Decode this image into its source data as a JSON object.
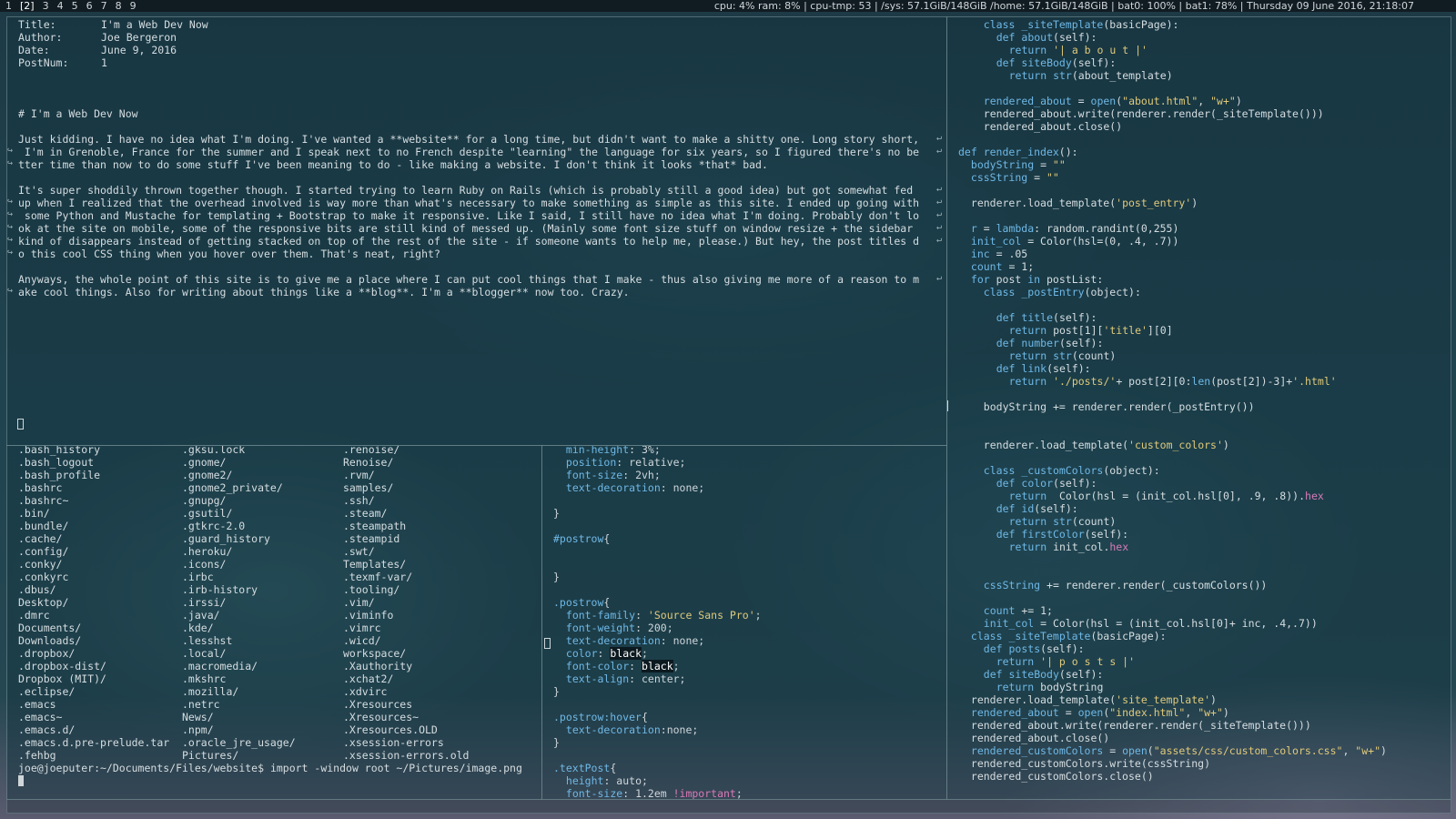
{
  "topbar": {
    "workspaces": [
      {
        "label": "1",
        "active": false
      },
      {
        "label": "[2]",
        "active": true
      },
      {
        "label": "3",
        "active": false
      },
      {
        "label": "4",
        "active": false
      },
      {
        "label": "5",
        "active": false
      },
      {
        "label": "6",
        "active": false
      },
      {
        "label": "7",
        "active": false
      },
      {
        "label": "8",
        "active": false
      },
      {
        "label": "9",
        "active": false
      }
    ],
    "sysinfo": "cpu: 4% ram: 8% | cpu-tmp: 53 | /sys: 57.1GiB/148GiB /home: 57.1GiB/148GiB | bat0: 100% | bat1: 78% | Thursday 09 June 2016, 21:18:07"
  },
  "post": {
    "meta": [
      {
        "key": "Title:",
        "value": "I'm a Web Dev Now"
      },
      {
        "key": "Author:",
        "value": "Joe Bergeron"
      },
      {
        "key": "Date:",
        "value": "June 9, 2016"
      },
      {
        "key": "PostNum:",
        "value": "1"
      }
    ],
    "lines": [
      {
        "row": 7,
        "text": "# I'm a Web Dev Now"
      },
      {
        "row": 9,
        "text": "Just kidding. I have no idea what I'm doing. I've wanted a **website** for a long time, but didn't want to make a shitty one. Long story short,",
        "wrap": true
      },
      {
        "row": 10,
        "text": " I'm in Grenoble, France for the summer and I speak next to no French despite \"learning\" the language for six years, so I figured there's no be",
        "wrap": true,
        "cont": true
      },
      {
        "row": 11,
        "text": "tter time than now to do some stuff I've been meaning to do - like making a website. I don't think it looks *that* bad.",
        "cont": true
      },
      {
        "row": 13,
        "text": "It's super shoddily thrown together though. I started trying to learn Ruby on Rails (which is probably still a good idea) but got somewhat fed",
        "wrap": true
      },
      {
        "row": 14,
        "text": "up when I realized that the overhead involved is way more than what's necessary to make something as simple as this site. I ended up going with",
        "wrap": true,
        "cont": true
      },
      {
        "row": 15,
        "text": " some Python and Mustache for templating + Bootstrap to make it responsive. Like I said, I still have no idea what I'm doing. Probably don't lo",
        "wrap": true,
        "cont": true
      },
      {
        "row": 16,
        "text": "ok at the site on mobile, some of the responsive bits are still kind of messed up. (Mainly some font size stuff on window resize + the sidebar",
        "wrap": true,
        "cont": true
      },
      {
        "row": 17,
        "text": "kind of disappears instead of getting stacked on top of the rest of the site - if someone wants to help me, please.) But hey, the post titles d",
        "wrap": true,
        "cont": true
      },
      {
        "row": 18,
        "text": "o this cool CSS thing when you hover over them. That's neat, right?",
        "cont": true
      },
      {
        "row": 20,
        "text": "Anyways, the whole point of this site is to give me a place where I can put cool things that I make - thus also giving me more of a reason to m",
        "wrap": true
      },
      {
        "row": 21,
        "text": "ake cool things. Also for writing about things like a **blog**. I'm a **blogger** now too. Crazy.",
        "cont": true
      }
    ]
  },
  "ls": {
    "columns": [
      [
        ".bash_history",
        ".bash_logout",
        ".bash_profile",
        ".bashrc",
        ".bashrc~",
        ".bin/",
        ".bundle/",
        ".cache/",
        ".config/",
        ".conky/",
        ".conkyrc",
        ".dbus/",
        "Desktop/",
        ".dmrc",
        "Documents/",
        "Downloads/",
        ".dropbox/",
        ".dropbox-dist/",
        "Dropbox (MIT)/",
        ".eclipse/",
        ".emacs",
        ".emacs~",
        ".emacs.d/",
        ".emacs.d.pre-prelude.tar",
        ".fehbg"
      ],
      [
        ".gksu.lock",
        ".gnome/",
        ".gnome2/",
        ".gnome2_private/",
        ".gnupg/",
        ".gsutil/",
        ".gtkrc-2.0",
        ".guard_history",
        ".heroku/",
        ".icons/",
        ".irbc",
        ".irb-history",
        ".irssi/",
        ".java/",
        ".kde/",
        ".lesshst",
        ".local/",
        ".macromedia/",
        ".mkshrc",
        ".mozilla/",
        ".netrc",
        "News/",
        ".npm/",
        ".oracle_jre_usage/",
        "Pictures/"
      ],
      [
        ".renoise/",
        "Renoise/",
        ".rvm/",
        "samples/",
        ".ssh/",
        ".steam/",
        ".steampath",
        ".steampid",
        ".swt/",
        "Templates/",
        ".texmf-var/",
        ".tooling/",
        ".vim/",
        ".viminfo",
        ".vimrc",
        ".wicd/",
        "workspace/",
        ".Xauthority",
        ".xchat2/",
        ".xdvirc",
        ".Xresources",
        ".Xresources~",
        ".Xresources.OLD",
        ".xsession-errors",
        ".xsession-errors.old"
      ]
    ],
    "prompt": "joe@joeputer:~/Documents/Files/website$ import -window root ~/Pictures/image.png"
  },
  "css": [
    {
      "row": 0,
      "indent": 2,
      "prop": "min-height",
      "val": " 3%;"
    },
    {
      "row": 1,
      "indent": 2,
      "prop": "position",
      "val": " relative;"
    },
    {
      "row": 2,
      "indent": 2,
      "prop": "font-size",
      "val": " 2vh;"
    },
    {
      "row": 3,
      "indent": 2,
      "prop": "text-decoration",
      "val": " none;"
    },
    {
      "row": 5,
      "indent": 0,
      "brace": "}"
    },
    {
      "row": 7,
      "indent": 0,
      "sel": "#postrow",
      "brace": "{"
    },
    {
      "row": 10,
      "indent": 0,
      "brace": "}"
    },
    {
      "row": 12,
      "indent": 0,
      "sel": ".postrow",
      "brace": "{"
    },
    {
      "row": 13,
      "indent": 2,
      "prop": "font-family",
      "str": " 'Source Sans Pro'",
      "val": ";"
    },
    {
      "row": 14,
      "indent": 2,
      "prop": "font-weight",
      "val": " 200;"
    },
    {
      "row": 15,
      "indent": 2,
      "prop": "text-decoration",
      "val": " none;"
    },
    {
      "row": 16,
      "indent": 2,
      "prop": "color",
      "hl": "black",
      "val": ";"
    },
    {
      "row": 17,
      "indent": 2,
      "prop": "font-color",
      "hl": "black",
      "val": ";"
    },
    {
      "row": 18,
      "indent": 2,
      "prop": "text-align",
      "val": " center;"
    },
    {
      "row": 19,
      "indent": 0,
      "brace": "}"
    },
    {
      "row": 21,
      "indent": 0,
      "sel": ".postrow:hover",
      "brace": "{"
    },
    {
      "row": 22,
      "indent": 2,
      "prop": "text-decoration",
      "val": "none;"
    },
    {
      "row": 23,
      "indent": 0,
      "brace": "}"
    },
    {
      "row": 25,
      "indent": 0,
      "sel": ".textPost",
      "brace": "{"
    },
    {
      "row": 26,
      "indent": 2,
      "prop": "height",
      "val": " auto;"
    },
    {
      "row": 27,
      "indent": 2,
      "prop": "font-size",
      "val": " 1.2em ",
      "imp": "!important",
      "tail": ";"
    }
  ],
  "python": [
    {
      "row": 0,
      "indent": 4,
      "parts": [
        [
          "kw",
          "class "
        ],
        [
          "fn",
          "_siteTemplate"
        ],
        [
          "pl",
          "(basicPage):"
        ]
      ]
    },
    {
      "row": 1,
      "indent": 6,
      "parts": [
        [
          "kw",
          "def "
        ],
        [
          "fn",
          "about"
        ],
        [
          "pl",
          "(self):"
        ]
      ]
    },
    {
      "row": 2,
      "indent": 8,
      "parts": [
        [
          "kw",
          "return "
        ],
        [
          "str",
          "'| a b o u t |'"
        ]
      ]
    },
    {
      "row": 3,
      "indent": 6,
      "parts": [
        [
          "kw",
          "def "
        ],
        [
          "fn",
          "siteBody"
        ],
        [
          "pl",
          "(self):"
        ]
      ]
    },
    {
      "row": 4,
      "indent": 8,
      "parts": [
        [
          "kw",
          "return "
        ],
        [
          "fn",
          "str"
        ],
        [
          "pl",
          "(about_template)"
        ]
      ]
    },
    {
      "row": 6,
      "indent": 4,
      "parts": [
        [
          "fn",
          "rendered_about"
        ],
        [
          "pl",
          " = "
        ],
        [
          "fn",
          "open"
        ],
        [
          "pl",
          "("
        ],
        [
          "str",
          "\"about.html\""
        ],
        [
          "pl",
          ", "
        ],
        [
          "str",
          "\"w+\""
        ],
        [
          "pl",
          ")"
        ]
      ]
    },
    {
      "row": 7,
      "indent": 4,
      "parts": [
        [
          "pl",
          "rendered_about.write(renderer.render(_siteTemplate()))"
        ]
      ]
    },
    {
      "row": 8,
      "indent": 4,
      "parts": [
        [
          "pl",
          "rendered_about.close()"
        ]
      ]
    },
    {
      "row": 10,
      "indent": 0,
      "parts": [
        [
          "kw",
          "def "
        ],
        [
          "fn",
          "render_index"
        ],
        [
          "pl",
          "():"
        ]
      ]
    },
    {
      "row": 11,
      "indent": 2,
      "parts": [
        [
          "fn",
          "bodyString"
        ],
        [
          "pl",
          " = "
        ],
        [
          "str",
          "\"\""
        ]
      ]
    },
    {
      "row": 12,
      "indent": 2,
      "parts": [
        [
          "fn",
          "cssString"
        ],
        [
          "pl",
          " = "
        ],
        [
          "str",
          "\"\""
        ]
      ]
    },
    {
      "row": 14,
      "indent": 2,
      "parts": [
        [
          "pl",
          "renderer.load_template("
        ],
        [
          "str",
          "'post_entry'"
        ],
        [
          "pl",
          ")"
        ]
      ]
    },
    {
      "row": 16,
      "indent": 2,
      "parts": [
        [
          "fn",
          "r"
        ],
        [
          "pl",
          " = "
        ],
        [
          "kw",
          "lambda"
        ],
        [
          "pl",
          ": random.randint(0,255)"
        ]
      ]
    },
    {
      "row": 17,
      "indent": 2,
      "parts": [
        [
          "fn",
          "init_col"
        ],
        [
          "pl",
          " = Color(hsl=(0, .4, .7))"
        ]
      ]
    },
    {
      "row": 18,
      "indent": 2,
      "parts": [
        [
          "fn",
          "inc"
        ],
        [
          "pl",
          " = .05"
        ]
      ]
    },
    {
      "row": 19,
      "indent": 2,
      "parts": [
        [
          "fn",
          "count"
        ],
        [
          "pl",
          " = 1;"
        ]
      ]
    },
    {
      "row": 20,
      "indent": 2,
      "parts": [
        [
          "kw",
          "for "
        ],
        [
          "pl",
          "post "
        ],
        [
          "kw",
          "in "
        ],
        [
          "pl",
          "postList:"
        ]
      ]
    },
    {
      "row": 21,
      "indent": 4,
      "parts": [
        [
          "kw",
          "class "
        ],
        [
          "fn",
          "_postEntry"
        ],
        [
          "pl",
          "(object):"
        ]
      ]
    },
    {
      "row": 23,
      "indent": 6,
      "parts": [
        [
          "kw",
          "def "
        ],
        [
          "fn",
          "title"
        ],
        [
          "pl",
          "(self):"
        ]
      ]
    },
    {
      "row": 24,
      "indent": 8,
      "parts": [
        [
          "kw",
          "return "
        ],
        [
          "pl",
          "post[1]["
        ],
        [
          "str",
          "'title'"
        ],
        [
          "pl",
          "][0]"
        ]
      ]
    },
    {
      "row": 25,
      "indent": 6,
      "parts": [
        [
          "kw",
          "def "
        ],
        [
          "fn",
          "number"
        ],
        [
          "pl",
          "(self):"
        ]
      ]
    },
    {
      "row": 26,
      "indent": 8,
      "parts": [
        [
          "kw",
          "return "
        ],
        [
          "fn",
          "str"
        ],
        [
          "pl",
          "(count)"
        ]
      ]
    },
    {
      "row": 27,
      "indent": 6,
      "parts": [
        [
          "kw",
          "def "
        ],
        [
          "fn",
          "link"
        ],
        [
          "pl",
          "(self):"
        ]
      ]
    },
    {
      "row": 28,
      "indent": 8,
      "parts": [
        [
          "kw",
          "return "
        ],
        [
          "str",
          "'./posts/'"
        ],
        [
          "pl",
          "+ post[2][0:"
        ],
        [
          "fn",
          "len"
        ],
        [
          "pl",
          "(post[2])-3]+"
        ],
        [
          "str",
          "'.html'"
        ]
      ]
    },
    {
      "row": 30,
      "indent": 4,
      "parts": [
        [
          "pl",
          "bodyString += renderer.render(_postEntry())"
        ]
      ]
    },
    {
      "row": 33,
      "indent": 4,
      "parts": [
        [
          "pl",
          "renderer.load_template("
        ],
        [
          "str",
          "'custom_colors'"
        ],
        [
          "pl",
          ")"
        ]
      ]
    },
    {
      "row": 35,
      "indent": 4,
      "parts": [
        [
          "kw",
          "class "
        ],
        [
          "fn",
          "_customColors"
        ],
        [
          "pl",
          "(object):"
        ]
      ]
    },
    {
      "row": 36,
      "indent": 6,
      "parts": [
        [
          "kw",
          "def "
        ],
        [
          "fn",
          "color"
        ],
        [
          "pl",
          "(self):"
        ]
      ]
    },
    {
      "row": 37,
      "indent": 8,
      "parts": [
        [
          "kw",
          "return "
        ],
        [
          "pl",
          " Color(hsl = (init_col.hsl[0], .9, .8))."
        ],
        [
          "imp",
          "hex"
        ]
      ]
    },
    {
      "row": 38,
      "indent": 6,
      "parts": [
        [
          "kw",
          "def "
        ],
        [
          "fn",
          "id"
        ],
        [
          "pl",
          "(self):"
        ]
      ]
    },
    {
      "row": 39,
      "indent": 8,
      "parts": [
        [
          "kw",
          "return "
        ],
        [
          "fn",
          "str"
        ],
        [
          "pl",
          "(count)"
        ]
      ]
    },
    {
      "row": 40,
      "indent": 6,
      "parts": [
        [
          "kw",
          "def "
        ],
        [
          "fn",
          "firstColor"
        ],
        [
          "pl",
          "(self):"
        ]
      ]
    },
    {
      "row": 41,
      "indent": 8,
      "parts": [
        [
          "kw",
          "return "
        ],
        [
          "pl",
          "init_col."
        ],
        [
          "imp",
          "hex"
        ]
      ]
    },
    {
      "row": 44,
      "indent": 4,
      "parts": [
        [
          "fn",
          "cssString"
        ],
        [
          "pl",
          " += renderer.render(_customColors())"
        ]
      ]
    },
    {
      "row": 46,
      "indent": 4,
      "parts": [
        [
          "fn",
          "count"
        ],
        [
          "pl",
          " += 1;"
        ]
      ]
    },
    {
      "row": 47,
      "indent": 4,
      "parts": [
        [
          "fn",
          "init_col"
        ],
        [
          "pl",
          " = Color(hsl = (init_col.hsl[0]+ inc, .4,.7))"
        ]
      ]
    },
    {
      "row": 48,
      "indent": 2,
      "parts": [
        [
          "kw",
          "class "
        ],
        [
          "fn",
          "_siteTemplate"
        ],
        [
          "pl",
          "(basicPage):"
        ]
      ]
    },
    {
      "row": 49,
      "indent": 4,
      "parts": [
        [
          "kw",
          "def "
        ],
        [
          "fn",
          "posts"
        ],
        [
          "pl",
          "(self):"
        ]
      ]
    },
    {
      "row": 50,
      "indent": 6,
      "parts": [
        [
          "kw",
          "return "
        ],
        [
          "str",
          "'| p o s t s |'"
        ]
      ]
    },
    {
      "row": 51,
      "indent": 4,
      "parts": [
        [
          "kw",
          "def "
        ],
        [
          "fn",
          "siteBody"
        ],
        [
          "pl",
          "(self):"
        ]
      ]
    },
    {
      "row": 52,
      "indent": 6,
      "parts": [
        [
          "kw",
          "return "
        ],
        [
          "pl",
          "bodyString"
        ]
      ]
    },
    {
      "row": 53,
      "indent": 2,
      "parts": [
        [
          "pl",
          "renderer.load_template("
        ],
        [
          "str",
          "'site_template'"
        ],
        [
          "pl",
          ")"
        ]
      ]
    },
    {
      "row": 54,
      "indent": 2,
      "parts": [
        [
          "fn",
          "rendered_about"
        ],
        [
          "pl",
          " = "
        ],
        [
          "fn",
          "open"
        ],
        [
          "pl",
          "("
        ],
        [
          "str",
          "\"index.html\""
        ],
        [
          "pl",
          ", "
        ],
        [
          "str",
          "\"w+\""
        ],
        [
          "pl",
          ")"
        ]
      ]
    },
    {
      "row": 55,
      "indent": 2,
      "parts": [
        [
          "pl",
          "rendered_about.write(renderer.render(_siteTemplate()))"
        ]
      ]
    },
    {
      "row": 56,
      "indent": 2,
      "parts": [
        [
          "pl",
          "rendered_about.close()"
        ]
      ]
    },
    {
      "row": 57,
      "indent": 2,
      "parts": [
        [
          "fn",
          "rendered_customColors"
        ],
        [
          "pl",
          " = "
        ],
        [
          "fn",
          "open"
        ],
        [
          "pl",
          "("
        ],
        [
          "str",
          "\"assets/css/custom_colors.css\""
        ],
        [
          "pl",
          ", "
        ],
        [
          "str",
          "\"w+\""
        ],
        [
          "pl",
          ")"
        ]
      ]
    },
    {
      "row": 58,
      "indent": 2,
      "parts": [
        [
          "pl",
          "rendered_customColors.write(cssString)"
        ]
      ]
    },
    {
      "row": 59,
      "indent": 2,
      "parts": [
        [
          "pl",
          "rendered_customColors.close()"
        ]
      ]
    }
  ]
}
